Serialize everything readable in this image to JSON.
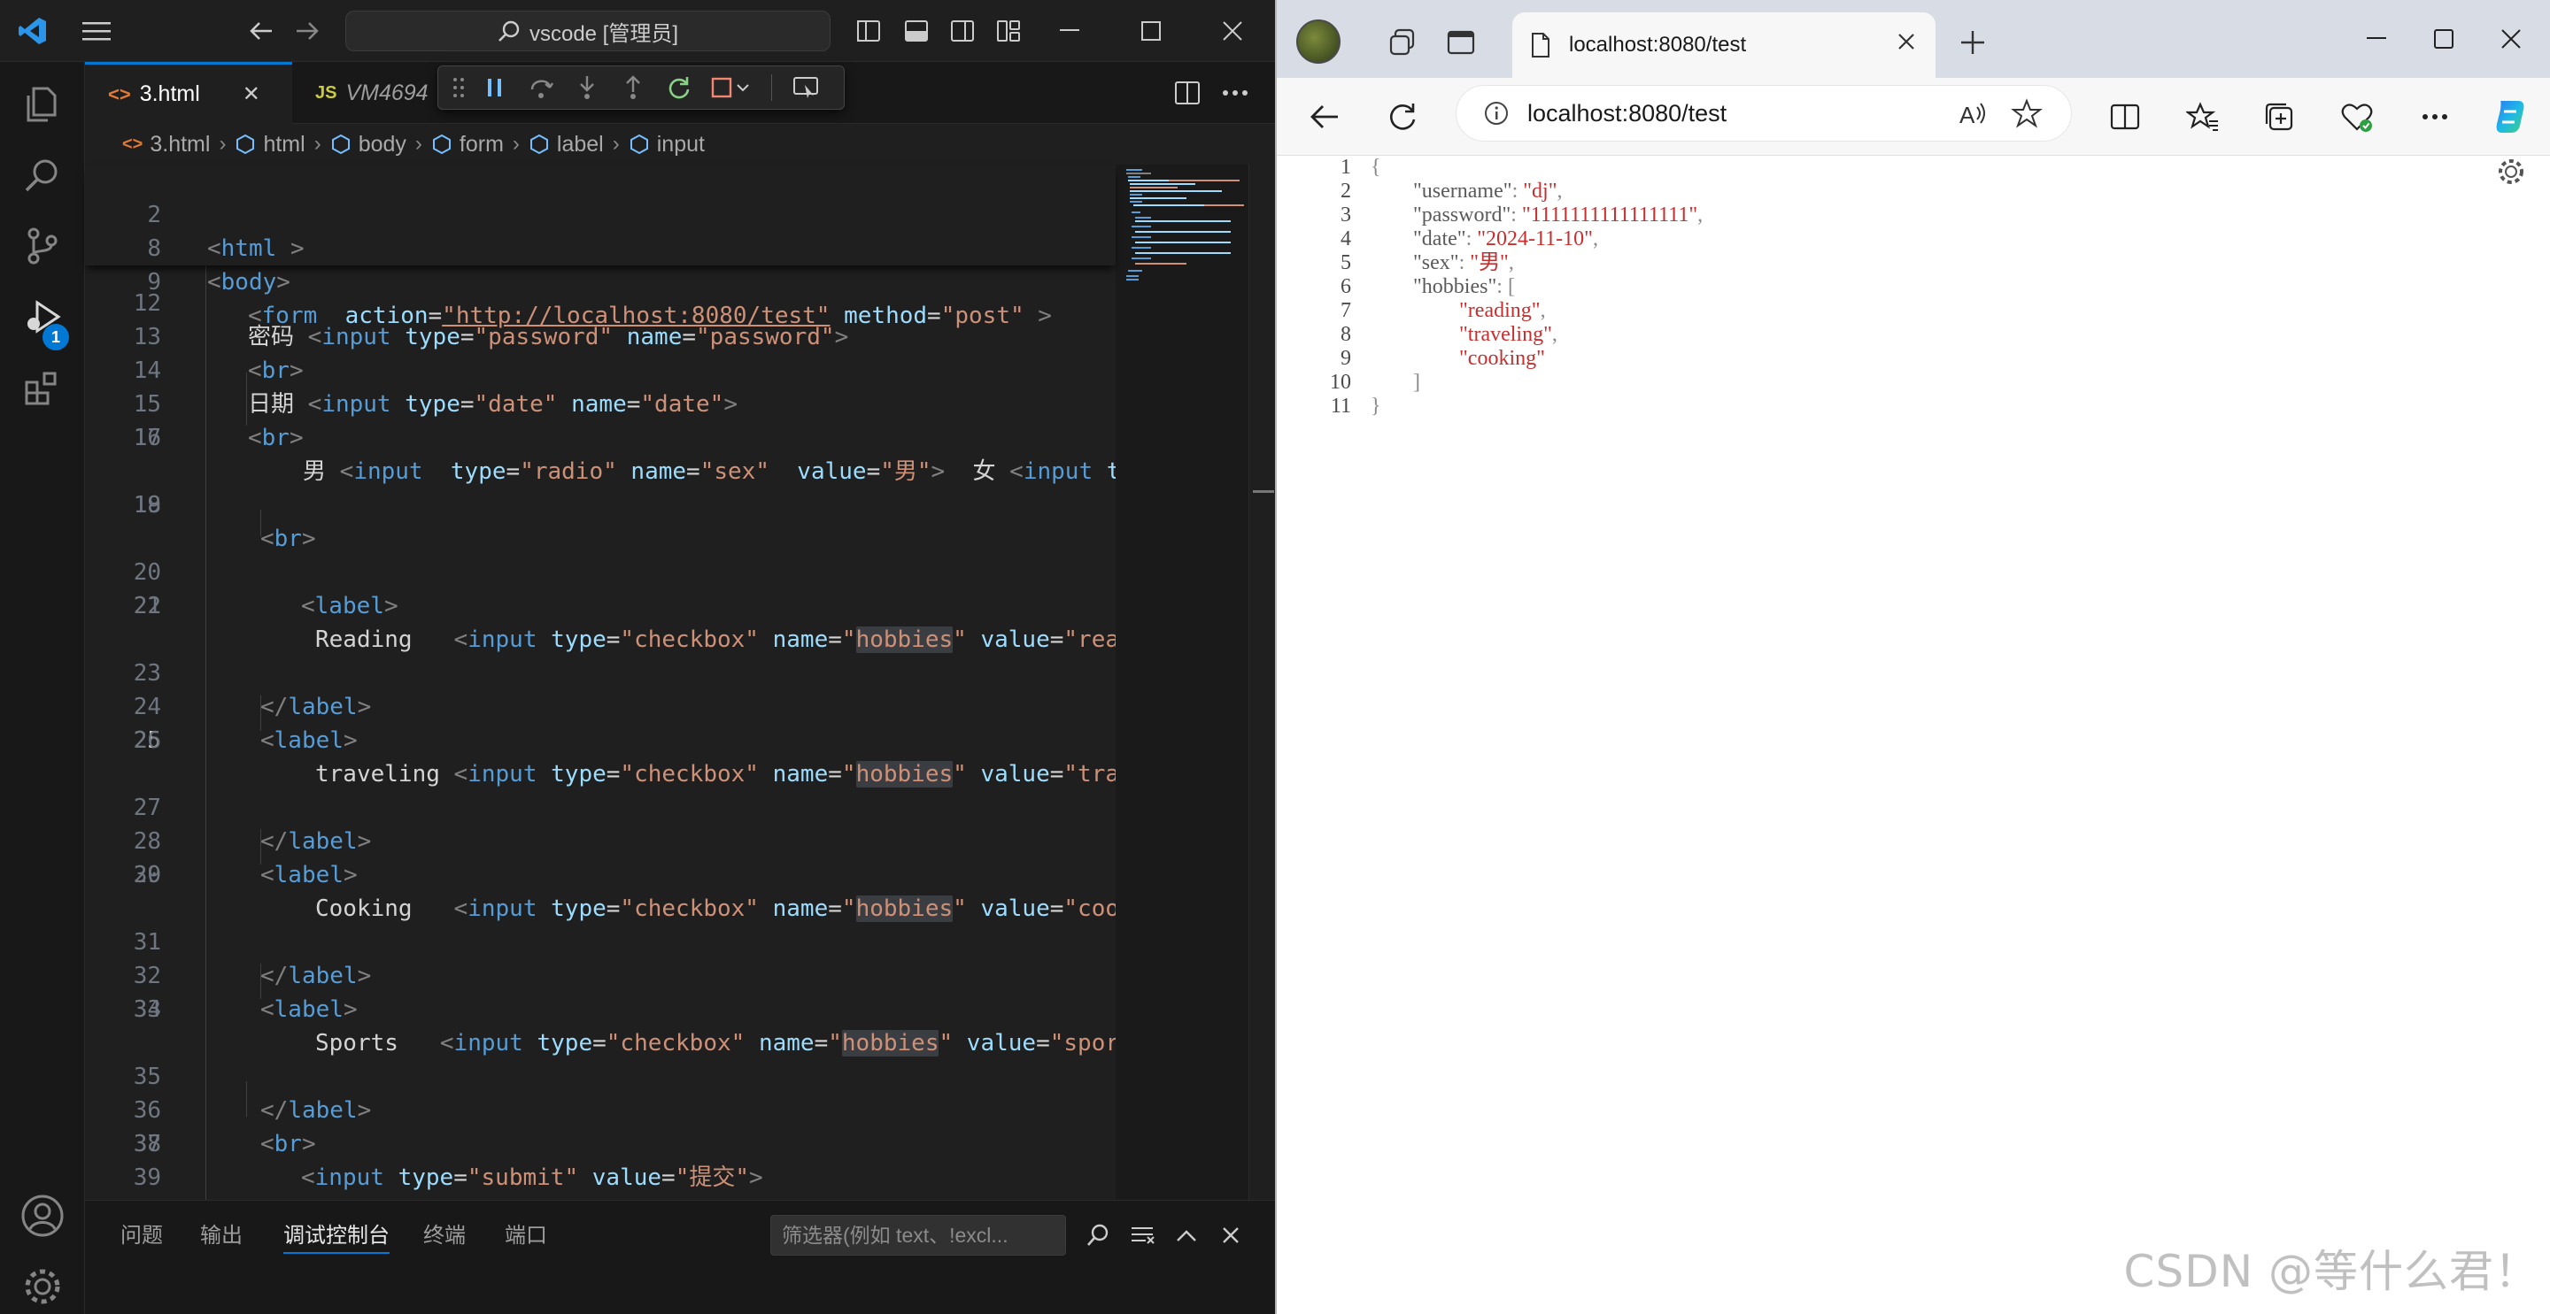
{
  "vscode": {
    "command_center": "vscode [管理员]",
    "tabs": [
      {
        "icon": "<>",
        "label": "3.html",
        "close": "✕"
      },
      {
        "icon": "JS",
        "label": "VM4694"
      }
    ],
    "breadcrumb": [
      "3.html",
      "html",
      "body",
      "form",
      "label",
      "input"
    ],
    "sticky_lines": [
      {
        "num": "2",
        "indent": 0,
        "tag": "html"
      },
      {
        "num": "8",
        "indent": 0,
        "tag": "body"
      },
      {
        "num": "9",
        "indent": 1,
        "tag": "form",
        "action_value": "\"http://localhost:8080/test\"",
        "method_value": "\"post\""
      }
    ],
    "partial_line": {
      "num": "12",
      "text": "密码 <input type=\"password\" name=\"password\">"
    },
    "lines": [
      {
        "num": "13",
        "code": "br"
      },
      {
        "num": "14",
        "code": "date"
      },
      {
        "num": "15",
        "code": "br2"
      },
      {
        "num": "16",
        "code": "radio"
      },
      {
        "num": "17",
        "code": ""
      },
      {
        "num": "18",
        "code": "br3"
      },
      {
        "num": "19",
        "code": ""
      },
      {
        "num": "20",
        "code": "label1"
      },
      {
        "num": "21",
        "code": "reading"
      },
      {
        "num": "22",
        "code": ""
      },
      {
        "num": "23",
        "code": "endlabel1"
      },
      {
        "num": "24",
        "code": "label2"
      },
      {
        "num": "25",
        "code": "traveling"
      },
      {
        "num": "26",
        "code": ""
      },
      {
        "num": "27",
        "code": "endlabel2"
      },
      {
        "num": "28",
        "code": "label3"
      },
      {
        "num": "29",
        "code": "cooking"
      },
      {
        "num": "30",
        "code": ""
      },
      {
        "num": "31",
        "code": "endlabel3"
      },
      {
        "num": "32",
        "code": "label4"
      },
      {
        "num": "33",
        "code": "sports"
      },
      {
        "num": "34",
        "code": ""
      },
      {
        "num": "35",
        "code": "endlabel4"
      },
      {
        "num": "36",
        "code": "br4"
      },
      {
        "num": "37",
        "code": "submit"
      },
      {
        "num": "38",
        "code": ""
      },
      {
        "num": "39",
        "code": ""
      }
    ],
    "code_text": {
      "date_label": "日期 ",
      "radio_male": "男 ",
      "radio_female": "女 ",
      "reading": "Reading   ",
      "traveling": "traveling ",
      "cooking": "Cooking   ",
      "sports": "Sports   ",
      "hobbies": "hobbies",
      "val_reading": "\"read",
      "val_traveling": "\"trav",
      "val_cooking": "\"cook",
      "val_sports": "\"sport",
      "submit_value": "\"提交\""
    },
    "current_line": "25",
    "panel_tabs": [
      "问题",
      "输出",
      "调试控制台",
      "终端",
      "端口"
    ],
    "active_panel_tab": "调试控制台",
    "filter_placeholder": "筛选器(例如 text、!excl...",
    "debug_badge": "1"
  },
  "browser": {
    "tab_title": "localhost:8080/test",
    "url": "localhost:8080/test",
    "json_lines": [
      {
        "num": "1",
        "text": "{"
      },
      {
        "num": "2",
        "key": "\"username\"",
        "value": "\"dj\"",
        "comma": ","
      },
      {
        "num": "3",
        "key": "\"password\"",
        "value": "\"1111111111111111\"",
        "comma": ","
      },
      {
        "num": "4",
        "key": "\"date\"",
        "value": "\"2024-11-10\"",
        "comma": ","
      },
      {
        "num": "5",
        "key": "\"sex\"",
        "value": "\"男\"",
        "comma": ","
      },
      {
        "num": "6",
        "key": "\"hobbies\"",
        "text": "["
      },
      {
        "num": "7",
        "item": "\"reading\"",
        "comma": ","
      },
      {
        "num": "8",
        "item": "\"traveling\"",
        "comma": ","
      },
      {
        "num": "9",
        "item": "\"cooking\"",
        "comma": ""
      },
      {
        "num": "10",
        "text": "]"
      },
      {
        "num": "11",
        "text": "}"
      }
    ],
    "watermark": "CSDN @等什么君！"
  }
}
